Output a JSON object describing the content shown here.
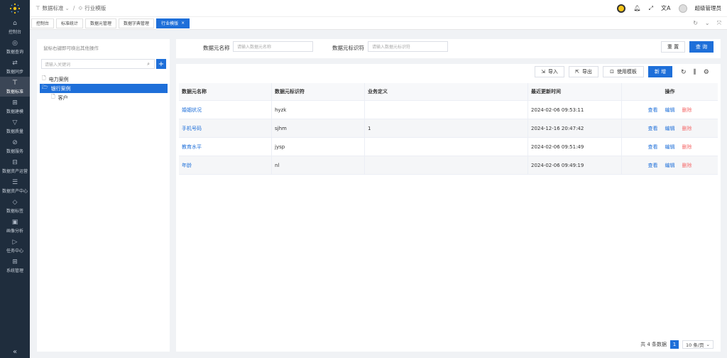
{
  "sidebar": {
    "items": [
      {
        "label": "控制台",
        "icon": "⌂"
      },
      {
        "label": "数据查询",
        "icon": "◎"
      },
      {
        "label": "数据同步",
        "icon": "⇄"
      },
      {
        "label": "数据标准",
        "icon": "⊤"
      },
      {
        "label": "数据建模",
        "icon": "⊞"
      },
      {
        "label": "数据质量",
        "icon": "▽"
      },
      {
        "label": "数据服务",
        "icon": "⊘"
      },
      {
        "label": "数据资产运营",
        "icon": "⊟"
      },
      {
        "label": "数据资产中心",
        "icon": "☰"
      },
      {
        "label": "数据标签",
        "icon": "◇"
      },
      {
        "label": "画像分析",
        "icon": "▣"
      },
      {
        "label": "任务中心",
        "icon": "▷"
      },
      {
        "label": "系统管理",
        "icon": "⊞"
      }
    ],
    "active_index": 3,
    "collapse_glyph": "«"
  },
  "header": {
    "breadcrumb": [
      "数据标准",
      "行业模版"
    ],
    "breadcrumb_dropdown": "⌄",
    "username": "超级管理员"
  },
  "tabs": [
    {
      "label": "控制台"
    },
    {
      "label": "标准统计"
    },
    {
      "label": "数据元管理"
    },
    {
      "label": "数据字典管理"
    },
    {
      "label": "行业模版",
      "active": true
    }
  ],
  "tab_close_glyph": "×",
  "left": {
    "hint": "鼠标右键即可唤出其他操作",
    "search_placeholder": "请输入关键词",
    "add_glyph": "+",
    "tree": [
      {
        "label": "电力案例",
        "level": 0
      },
      {
        "label": "银行案例",
        "level": 0,
        "selected": true
      },
      {
        "label": "客户",
        "level": 1
      }
    ]
  },
  "filter": {
    "name_label": "数据元名称",
    "name_placeholder": "请输入数据元名称",
    "id_label": "数据元标识符",
    "id_placeholder": "请输入数据元标识符",
    "reset_label": "重 置",
    "query_label": "查 询"
  },
  "toolbar": {
    "import_label": "导入",
    "export_label": "导出",
    "template_label": "使用模板",
    "add_label": "新 增"
  },
  "table": {
    "columns": [
      "数据元名称",
      "数据元标识符",
      "业务定义",
      "最近更新时间",
      "操作"
    ],
    "rows": [
      {
        "name": "婚姻状况",
        "code": "hyzk",
        "definition": "",
        "updated": "2024-02-06 09:53:11"
      },
      {
        "name": "手机号码",
        "code": "sjhm",
        "definition": "1",
        "updated": "2024-12-16 20:47:42"
      },
      {
        "name": "教育水平",
        "code": "jysp",
        "definition": "",
        "updated": "2024-02-06 09:51:49"
      },
      {
        "name": "年龄",
        "code": "nl",
        "definition": "",
        "updated": "2024-02-06 09:49:19"
      }
    ],
    "actions": {
      "view": "查看",
      "edit": "编辑",
      "delete": "删除"
    }
  },
  "pager": {
    "total_text": "共 4 条数据",
    "current_page": "1",
    "page_size": "10 条/页"
  }
}
